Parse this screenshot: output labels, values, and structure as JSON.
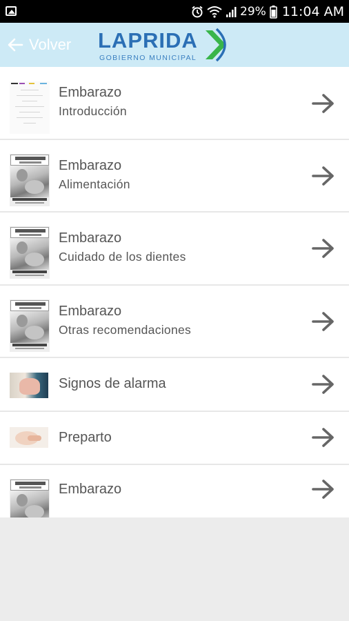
{
  "status_bar": {
    "battery_percent": "29%",
    "time": "11:04 AM",
    "icons": [
      "gallery-icon",
      "alarm-icon",
      "wifi-icon",
      "signal-icon",
      "battery-icon"
    ]
  },
  "app_bar": {
    "back_label": "Volver",
    "logo": {
      "name": "LAPRIDA",
      "subtitle": "GOBIERNO MUNICIPAL"
    },
    "colors": {
      "bar": "#cdeaf6",
      "logo_blue": "#2b6fb5",
      "chevron_green": "#39b54a"
    }
  },
  "items": [
    {
      "title": "Embarazo",
      "subtitle": "Introducción",
      "thumb": "intro-document"
    },
    {
      "title": "Embarazo",
      "subtitle": "Alimentación",
      "thumb": "libreta-sanitaria"
    },
    {
      "title": "Embarazo",
      "subtitle": "Cuidado de los dientes",
      "thumb": "libreta-sanitaria"
    },
    {
      "title": "Embarazo",
      "subtitle": "Otras recomendaciones",
      "thumb": "libreta-sanitaria"
    },
    {
      "title": "Signos de alarma",
      "subtitle": "",
      "thumb": "pregnant-photo"
    },
    {
      "title": "Preparto",
      "subtitle": "",
      "thumb": "belly-photo"
    },
    {
      "title": "Embarazo",
      "subtitle": "",
      "thumb": "libreta-sanitaria"
    }
  ]
}
